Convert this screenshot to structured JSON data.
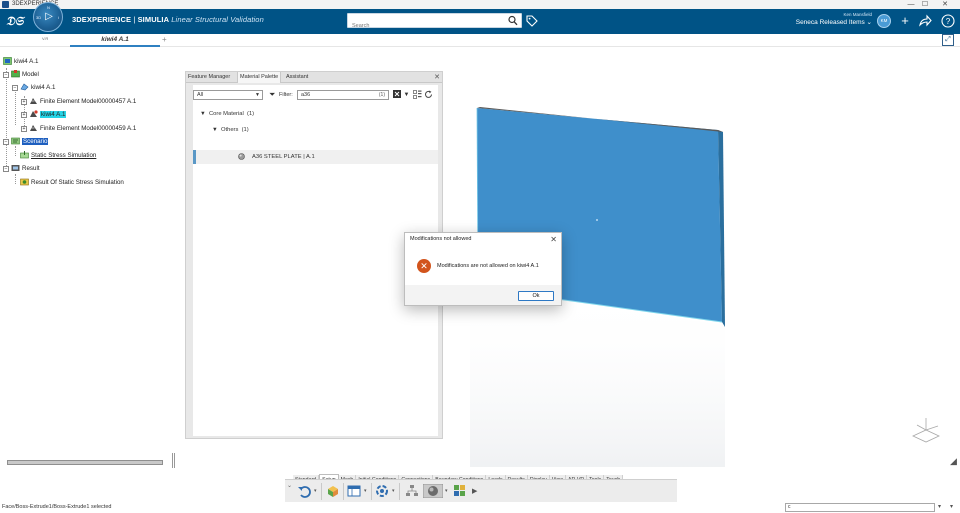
{
  "os": {
    "title": "3DEXPERIENCE",
    "min": "—",
    "max": "☐",
    "close": "✕"
  },
  "header": {
    "brand_bold": "3DEXPERIENCE",
    "brand_sep": " | ",
    "brand_product": "SIMULIA",
    "app_name": "Linear Structural Validation",
    "compass_version": "V.R",
    "search_placeholder": "Search",
    "user_name": "Ken Mansfield",
    "collab_space": "Seneca Released Items ⌄",
    "avatar_initials": "KM"
  },
  "tabs": {
    "doc_tab": "kiwi4 A.1",
    "add": "+"
  },
  "tree": {
    "root": "kiwi4 A.1",
    "model": "Model",
    "model_child": "kiwi4 A.1",
    "fem1": "Finite Element Model00000457 A.1",
    "fem_selected": "kiwi4 A.1",
    "fem2": "Finite Element Model00000459 A.1",
    "scenario": "Scenario",
    "static": "Static Stress Simulation",
    "result": "Result",
    "result_child": "Result Of Static Stress Simulation"
  },
  "palette": {
    "tabs": [
      "Feature Manager",
      "Material Palette",
      "Assistant"
    ],
    "type_select": "All",
    "filter_label": "Filter:",
    "filter_value": "a36",
    "filter_count": "(1)",
    "group": "Core Material",
    "group_count": "(1)",
    "subgroup": "Others",
    "subgroup_count": "(1)",
    "material": "A36 STEEL PLATE | A.1"
  },
  "dialog": {
    "title": "Modifications not allowed",
    "message": "Modifications are not allowed on kiwi4 A.1",
    "ok": "Ok"
  },
  "action_bar": {
    "tabs": [
      "Standard",
      "Setup",
      "Mesh",
      "Initial Conditions",
      "Connections",
      "Boundary Conditions",
      "Loads",
      "Results",
      "Display",
      "View",
      "AR-VR",
      "Tools",
      "Touch"
    ],
    "active_tab": "Setup"
  },
  "status": {
    "text": "Face/Boss-Extrude1/Boss-Extrude1 selected",
    "cmd_value": "c"
  },
  "colors": {
    "header_bg": "#005386",
    "plate_face": "#3f8fcb",
    "error_icon": "#d2541c",
    "selection_cyan": "#26d4e6"
  }
}
